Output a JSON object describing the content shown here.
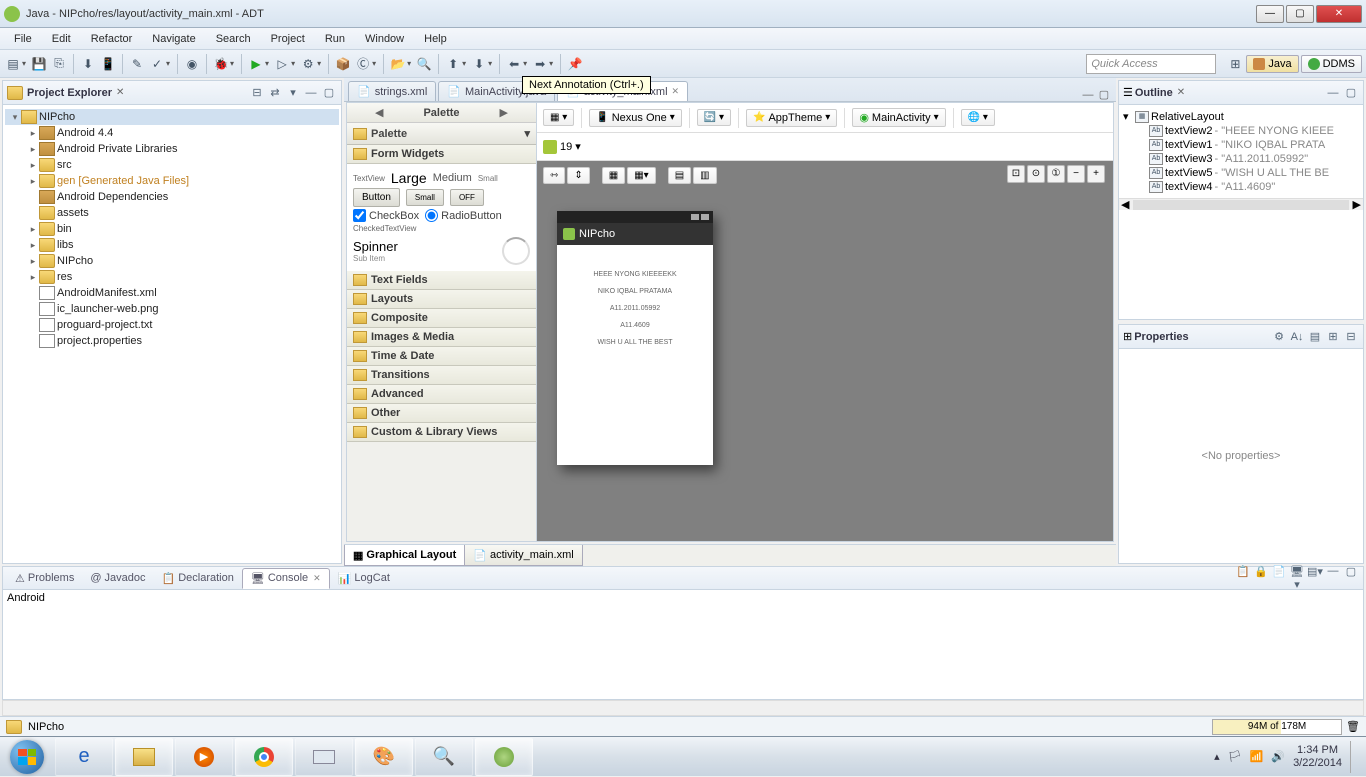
{
  "window": {
    "title": "Java - NIPcho/res/layout/activity_main.xml - ADT"
  },
  "menu": [
    "File",
    "Edit",
    "Refactor",
    "Navigate",
    "Search",
    "Project",
    "Run",
    "Window",
    "Help"
  ],
  "tooltip": "Next Annotation (Ctrl+.)",
  "quick_access_placeholder": "Quick Access",
  "perspectives": {
    "java": "Java",
    "ddms": "DDMS"
  },
  "project_explorer": {
    "title": "Project Explorer",
    "items": [
      {
        "level": 0,
        "caret": "▾",
        "ico": "proj",
        "label": "NIPcho",
        "sel": true
      },
      {
        "level": 1,
        "caret": "▸",
        "ico": "pkg",
        "label": "Android 4.4"
      },
      {
        "level": 1,
        "caret": "▸",
        "ico": "pkg",
        "label": "Android Private Libraries"
      },
      {
        "level": 1,
        "caret": "▸",
        "ico": "folder",
        "label": "src"
      },
      {
        "level": 1,
        "caret": "▸",
        "ico": "folder",
        "label": "gen [Generated Java Files]",
        "cls": "gen"
      },
      {
        "level": 1,
        "caret": "",
        "ico": "pkg",
        "label": "Android Dependencies"
      },
      {
        "level": 1,
        "caret": "",
        "ico": "folder",
        "label": "assets"
      },
      {
        "level": 1,
        "caret": "▸",
        "ico": "folder",
        "label": "bin"
      },
      {
        "level": 1,
        "caret": "▸",
        "ico": "folder",
        "label": "libs"
      },
      {
        "level": 1,
        "caret": "▸",
        "ico": "folder",
        "label": "NIPcho"
      },
      {
        "level": 1,
        "caret": "▸",
        "ico": "folder",
        "label": "res"
      },
      {
        "level": 1,
        "caret": "",
        "ico": "file",
        "label": "AndroidManifest.xml"
      },
      {
        "level": 1,
        "caret": "",
        "ico": "file",
        "label": "ic_launcher-web.png"
      },
      {
        "level": 1,
        "caret": "",
        "ico": "file",
        "label": "proguard-project.txt"
      },
      {
        "level": 1,
        "caret": "",
        "ico": "file",
        "label": "project.properties"
      }
    ]
  },
  "editor_tabs": [
    {
      "label": "strings.xml",
      "active": false
    },
    {
      "label": "MainActivity.java",
      "active": false
    },
    {
      "label": "activity_main.xml",
      "active": true
    }
  ],
  "palette": {
    "title": "Palette",
    "form_widgets": "Form Widgets",
    "textview": "TextView",
    "large": "Large",
    "medium": "Medium",
    "small": "Small",
    "button": "Button",
    "btn_small": "Small",
    "off": "OFF",
    "checkbox": "CheckBox",
    "radio": "RadioButton",
    "checkedtv": "CheckedTextView",
    "spinner": "Spinner",
    "subitem": "Sub Item",
    "sections": [
      "Text Fields",
      "Layouts",
      "Composite",
      "Images & Media",
      "Time & Date",
      "Transitions",
      "Advanced",
      "Other",
      "Custom & Library Views"
    ]
  },
  "canvas_toolbar": {
    "device": "Nexus One",
    "theme": "AppTheme",
    "activity": "MainActivity",
    "api": "19"
  },
  "phone": {
    "app_name": "NIPcho",
    "lines": [
      "HEEE NYONG KIEEEEKK",
      "NIKO IQBAL PRATAMA",
      "A11.2011.05992",
      "A11.4609",
      "WISH U ALL THE BEST"
    ]
  },
  "editor_footer": {
    "graphical": "Graphical Layout",
    "xml": "activity_main.xml"
  },
  "outline": {
    "title": "Outline",
    "root": "RelativeLayout",
    "items": [
      {
        "id": "textView2",
        "text": "\"HEEE NYONG KIEEE"
      },
      {
        "id": "textView1",
        "text": "\"NIKO IQBAL PRATA"
      },
      {
        "id": "textView3",
        "text": "\"A11.2011.05992\""
      },
      {
        "id": "textView5",
        "text": "\"WISH U ALL THE BE"
      },
      {
        "id": "textView4",
        "text": "\"A11.4609\""
      }
    ]
  },
  "properties": {
    "title": "Properties",
    "empty": "<No properties>"
  },
  "bottom": {
    "tabs": [
      "Problems",
      "Javadoc",
      "Declaration",
      "Console",
      "LogCat"
    ],
    "active": 3,
    "console_text": "Android"
  },
  "status": {
    "project": "NIPcho",
    "heap": "94M of 178M"
  },
  "taskbar": {
    "time": "1:34 PM",
    "date": "3/22/2014"
  }
}
